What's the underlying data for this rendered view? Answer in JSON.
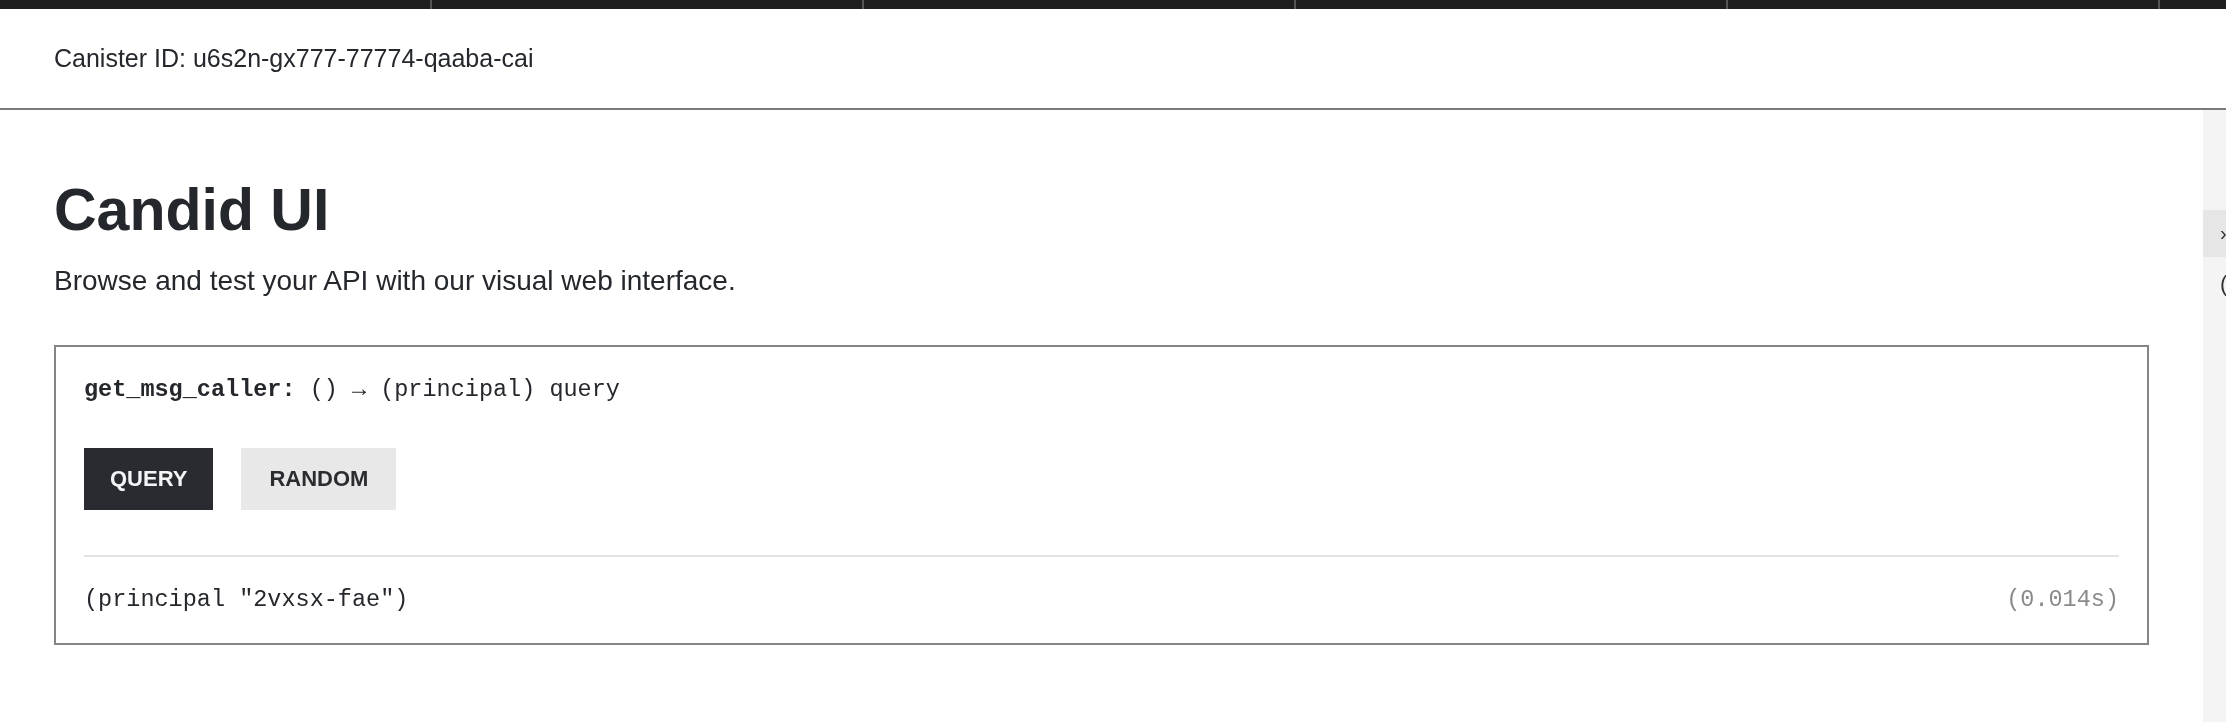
{
  "header": {
    "canister_id": "Canister ID: u6s2n-gx777-77774-qaaba-cai"
  },
  "title": "Candid UI",
  "subtitle": "Browse and test your API with our visual web interface.",
  "methods": [
    {
      "signature": "**get_msg_caller:** () → (principal) query",
      "buttons": [
        {
          "label": "QUERY",
          "kind": "primary"
        },
        {
          "label": "RANDOM",
          "kind": "secondary"
        }
      ],
      "result": "(principal \"2vxsx-fae\")",
      "duration": "(0.014s)"
    }
  ],
  "side_panel": {
    "toggle": "›",
    "log_text": "("
  }
}
